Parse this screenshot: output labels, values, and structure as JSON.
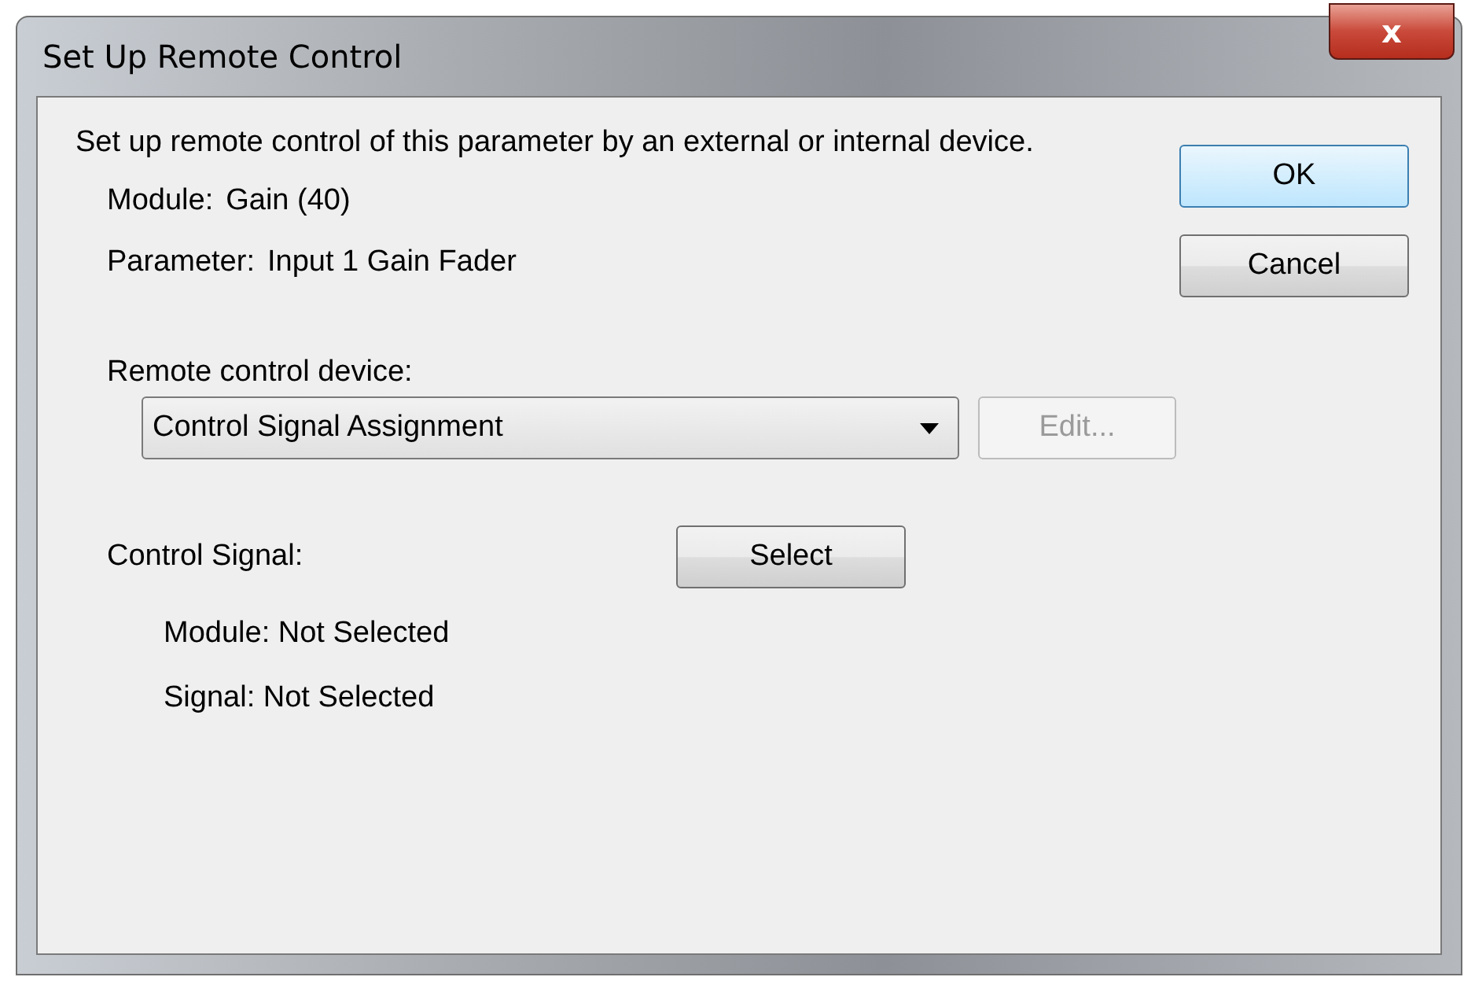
{
  "window": {
    "title": "Set Up Remote Control",
    "close": "x"
  },
  "intro": "Set up remote control of this parameter by an external or internal device.",
  "info": [
    {
      "label": "Module:",
      "value": "Gain (40)"
    },
    {
      "label": "Parameter:",
      "value": "Input 1 Gain Fader"
    }
  ],
  "remote_device": {
    "label": "Remote control device:",
    "value": "Control Signal Assignment",
    "edit": {
      "label": "Edit...",
      "disabled": true
    }
  },
  "control_signal": {
    "label": "Control Signal:",
    "button": "Select",
    "status": [
      "Module: Not Selected",
      "Signal: Not Selected"
    ]
  },
  "buttons": [
    {
      "label": "OK",
      "default": true
    },
    {
      "label": "Cancel",
      "default": false
    }
  ]
}
